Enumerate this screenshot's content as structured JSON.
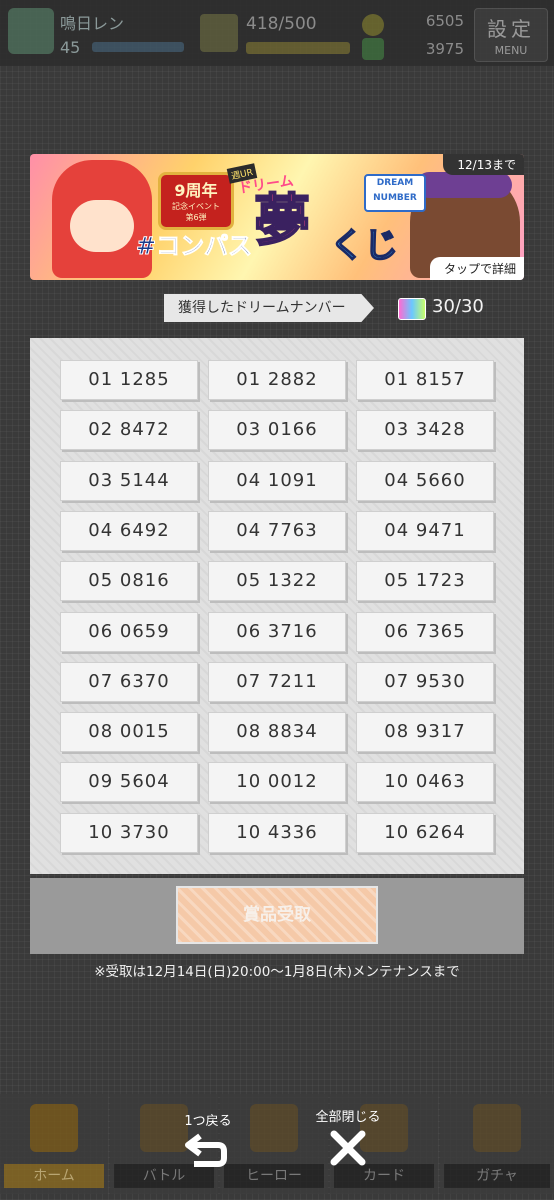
{
  "status": {
    "player_name": "鳴日レン",
    "level": "45",
    "stamina": "418/500",
    "coins": "6505",
    "gems": "3975",
    "settings_label": "設定",
    "menu_label": "MENU"
  },
  "banner": {
    "deadline": "12/13まで",
    "tap_detail": "タップで詳細",
    "anniversary": "9周年",
    "anniversary_sub": "記念イベント",
    "anniversary_round": "第6弾",
    "url_tag": "週UR",
    "hashtag": "#コンパス",
    "dream_kana": "ドリーム",
    "yume": "夢",
    "kuji": "くじ",
    "logo_line1": "DREAM",
    "logo_line2": "NUMBER"
  },
  "acquired": {
    "label": "獲得したドリームナンバー",
    "count": "30/30"
  },
  "numbers": [
    "01 1285",
    "01 2882",
    "01 8157",
    "02 8472",
    "03 0166",
    "03 3428",
    "03 5144",
    "04 1091",
    "04 5660",
    "04 6492",
    "04 7763",
    "04 9471",
    "05 0816",
    "05 1322",
    "05 1723",
    "06 0659",
    "06 3716",
    "06 7365",
    "07 6370",
    "07 7211",
    "07 9530",
    "08 0015",
    "08 8834",
    "08 9317",
    "09 5604",
    "10 0012",
    "10 0463",
    "10 3730",
    "10 4336",
    "10 6264"
  ],
  "claim_button": "賞品受取",
  "note": "※受取は12月14日(日)20:00〜1月8日(木)メンテナンスまで",
  "nav": {
    "home": "ホーム",
    "battle": "バトル",
    "hero": "ヒーロー",
    "card": "カード",
    "gacha": "ガチャ"
  },
  "overlay": {
    "back_label": "1つ戻る",
    "close_all_label": "全部閉じる"
  }
}
